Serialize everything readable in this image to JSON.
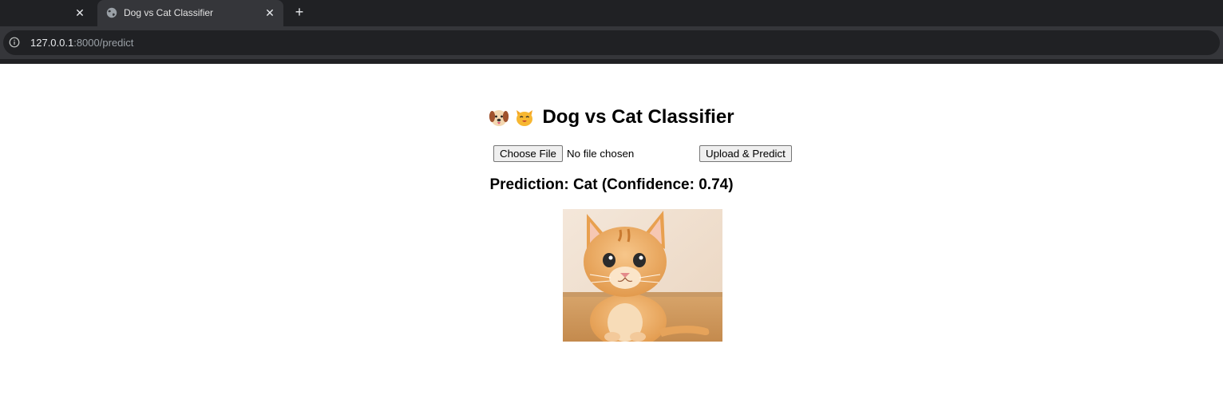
{
  "browser": {
    "tabs": [
      {
        "title": ""
      },
      {
        "title": "Dog vs Cat Classifier",
        "active": true
      }
    ],
    "address": {
      "host": "127.0.0.1",
      "path": ":8000/predict"
    }
  },
  "page": {
    "heading_emoji_1": "dog-face",
    "heading_emoji_2": "cat-face",
    "heading": "Dog vs Cat Classifier",
    "file_input": {
      "button_label": "Choose File",
      "status": "No file chosen"
    },
    "submit_label": "Upload & Predict",
    "prediction_text": "Prediction: Cat (Confidence: 0.74)",
    "result_image": "orange-kitten-photo"
  }
}
